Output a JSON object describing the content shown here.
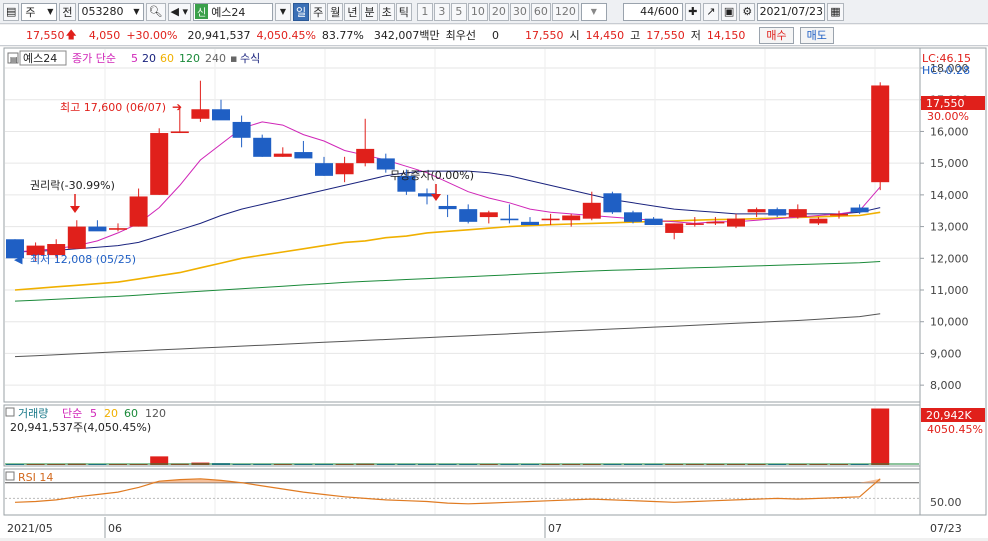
{
  "toolbar": {
    "market": "주",
    "prev_label": "전",
    "code": "053280",
    "type_badge": "신",
    "name": "예스24",
    "periods": [
      "일",
      "주",
      "월",
      "년",
      "분",
      "초",
      "틱"
    ],
    "active_period": "일",
    "intervals": [
      "1",
      "3",
      "5",
      "10",
      "20",
      "30",
      "60",
      "120"
    ],
    "count": "44",
    "count_total": "/600",
    "date": "2021/07/23"
  },
  "quote": {
    "price": "17,550",
    "change": "4,050",
    "change_pct": "+30.00%",
    "volume": "20,941,537",
    "volume_pct": "4,050.45%",
    "ratio": "83.77%",
    "amount": "342,007백만",
    "pref_label": "최우선",
    "pref_value": "0",
    "ask": "17,550",
    "open_label": "시",
    "open": "14,450",
    "high_label": "고",
    "high": "17,550",
    "low_label": "저",
    "low": "14,150",
    "buy_label": "매수",
    "sell_label": "매도"
  },
  "price_panel": {
    "name_tag": "예스24",
    "legend_prefix": "종가 단순",
    "ma": [
      "5",
      "20",
      "60",
      "120",
      "240"
    ],
    "formula_label": "수식",
    "lc": "LC:46.15",
    "hc": "HC:-0.28",
    "last_price_badge": "17,550",
    "last_pct_badge": "30.00%",
    "annotations": {
      "high": "최고 17,600 (06/07)",
      "low": "최저 12,008 (05/25)",
      "rights": "권리락(-30.99%)",
      "bonus": "무상증자(0.00%)"
    },
    "yaxis": [
      "18,000",
      "17,000",
      "16,000",
      "15,000",
      "14,000",
      "13,000",
      "12,000",
      "11,000",
      "10,000",
      "9,000",
      "8,000"
    ]
  },
  "volume_panel": {
    "title": "거래량",
    "legend_prefix": "단순",
    "ma": [
      "5",
      "20",
      "60",
      "120"
    ],
    "value_text": "20,941,537주(4,050.45%)",
    "badge": "20,942K",
    "badge_pct": "4050.45%"
  },
  "rsi_panel": {
    "title": "RSI 14",
    "ytick": "50.00"
  },
  "xaxis": {
    "labels": [
      "2021/05",
      "06",
      "07"
    ],
    "right_label": "07/23"
  },
  "colors": {
    "up": "#e0201b",
    "down": "#1f5fc4",
    "ma5": "#d026b8",
    "ma20": "#1a237e",
    "ma60": "#f0b000",
    "ma120": "#1b8a3a",
    "ma240": "#555555"
  },
  "chart_data": {
    "type": "candlestick",
    "candles": [
      {
        "o": 12600,
        "h": 12600,
        "l": 12000,
        "c": 12000
      },
      {
        "o": 12100,
        "h": 12500,
        "l": 11900,
        "c": 12400
      },
      {
        "o": 12100,
        "h": 12600,
        "l": 12008,
        "c": 12450
      },
      {
        "o": 12300,
        "h": 13200,
        "l": 12300,
        "c": 13000
      },
      {
        "o": 13000,
        "h": 13200,
        "l": 12900,
        "c": 12850
      },
      {
        "o": 12900,
        "h": 13100,
        "l": 12850,
        "c": 12950
      },
      {
        "o": 13000,
        "h": 14200,
        "l": 13000,
        "c": 13950
      },
      {
        "o": 14000,
        "h": 16100,
        "l": 14000,
        "c": 15950
      },
      {
        "o": 15950,
        "h": 16800,
        "l": 15950,
        "c": 16000
      },
      {
        "o": 16400,
        "h": 17600,
        "l": 16300,
        "c": 16700
      },
      {
        "o": 16700,
        "h": 17000,
        "l": 16400,
        "c": 16350
      },
      {
        "o": 16300,
        "h": 16500,
        "l": 15500,
        "c": 15800
      },
      {
        "o": 15800,
        "h": 15900,
        "l": 15200,
        "c": 15200
      },
      {
        "o": 15200,
        "h": 15500,
        "l": 15200,
        "c": 15300
      },
      {
        "o": 15350,
        "h": 15700,
        "l": 15250,
        "c": 15150
      },
      {
        "o": 15000,
        "h": 15200,
        "l": 14600,
        "c": 14600
      },
      {
        "o": 14650,
        "h": 15200,
        "l": 14400,
        "c": 15000
      },
      {
        "o": 15000,
        "h": 16400,
        "l": 14900,
        "c": 15450
      },
      {
        "o": 15150,
        "h": 15300,
        "l": 14700,
        "c": 14800
      },
      {
        "o": 14600,
        "h": 14800,
        "l": 14000,
        "c": 14100
      },
      {
        "o": 14050,
        "h": 14200,
        "l": 13700,
        "c": 13950
      },
      {
        "o": 13650,
        "h": 14000,
        "l": 13300,
        "c": 13550
      },
      {
        "o": 13550,
        "h": 13700,
        "l": 13100,
        "c": 13150
      },
      {
        "o": 13300,
        "h": 13500,
        "l": 13100,
        "c": 13450
      },
      {
        "o": 13250,
        "h": 13700,
        "l": 13100,
        "c": 13200
      },
      {
        "o": 13150,
        "h": 13300,
        "l": 13100,
        "c": 13050
      },
      {
        "o": 13200,
        "h": 13400,
        "l": 13050,
        "c": 13250
      },
      {
        "o": 13200,
        "h": 13400,
        "l": 13000,
        "c": 13350
      },
      {
        "o": 13250,
        "h": 14100,
        "l": 13200,
        "c": 13750
      },
      {
        "o": 14050,
        "h": 14100,
        "l": 13400,
        "c": 13450
      },
      {
        "o": 13450,
        "h": 13500,
        "l": 13100,
        "c": 13150
      },
      {
        "o": 13250,
        "h": 13300,
        "l": 13100,
        "c": 13050
      },
      {
        "o": 12800,
        "h": 13100,
        "l": 12600,
        "c": 13100
      },
      {
        "o": 13100,
        "h": 13300,
        "l": 13000,
        "c": 13100
      },
      {
        "o": 13100,
        "h": 13300,
        "l": 13050,
        "c": 13150
      },
      {
        "o": 13000,
        "h": 13400,
        "l": 12950,
        "c": 13250
      },
      {
        "o": 13450,
        "h": 13600,
        "l": 13300,
        "c": 13550
      },
      {
        "o": 13550,
        "h": 13600,
        "l": 13300,
        "c": 13350
      },
      {
        "o": 13300,
        "h": 13700,
        "l": 13250,
        "c": 13550
      },
      {
        "o": 13100,
        "h": 13300,
        "l": 13050,
        "c": 13250
      },
      {
        "o": 13350,
        "h": 13500,
        "l": 13250,
        "c": 13400
      },
      {
        "o": 13600,
        "h": 13700,
        "l": 13400,
        "c": 13450
      },
      {
        "o": 14400,
        "h": 17550,
        "l": 14150,
        "c": 17450
      }
    ],
    "ylim": [
      7500,
      18600
    ],
    "volume_ylim": [
      0,
      21500
    ],
    "volume": [
      300,
      200,
      250,
      600,
      200,
      150,
      500,
      3200,
      600,
      900,
      700,
      400,
      350,
      250,
      300,
      400,
      300,
      600,
      400,
      350,
      300,
      250,
      200,
      250,
      200,
      150,
      200,
      200,
      400,
      300,
      200,
      200,
      300,
      150,
      200,
      250,
      300,
      200,
      300,
      200,
      200,
      350,
      20942
    ],
    "ma5_values": [
      12200,
      12250,
      12300,
      12400,
      12550,
      12800,
      13100,
      13600,
      14300,
      15100,
      15600,
      16100,
      16300,
      16200,
      15900,
      15700,
      15400,
      15250,
      15100,
      14900,
      14700,
      14400,
      14100,
      13900,
      13750,
      13550,
      13450,
      13400,
      13350,
      13300,
      13250,
      13200,
      13150,
      13100,
      13150,
      13150,
      13200,
      13250,
      13300,
      13350,
      13400,
      13500,
      14250
    ],
    "ma20_values": [
      12200,
      12220,
      12250,
      12300,
      12350,
      12400,
      12500,
      12700,
      12900,
      13100,
      13350,
      13550,
      13700,
      13850,
      14000,
      14150,
      14300,
      14450,
      14600,
      14700,
      14750,
      14750,
      14750,
      14700,
      14600,
      14450,
      14300,
      14150,
      14000,
      13850,
      13750,
      13650,
      13550,
      13500,
      13450,
      13400,
      13400,
      13400,
      13400,
      13400,
      13400,
      13450,
      13600
    ],
    "ma60_values": [
      11000,
      11050,
      11100,
      11150,
      11200,
      11250,
      11350,
      11450,
      11550,
      11700,
      11850,
      12000,
      12100,
      12200,
      12300,
      12400,
      12500,
      12550,
      12650,
      12700,
      12800,
      12850,
      12900,
      12950,
      13000,
      13030,
      13060,
      13080,
      13100,
      13120,
      13140,
      13160,
      13180,
      13200,
      13220,
      13230,
      13250,
      13270,
      13290,
      13310,
      13330,
      13350,
      13450
    ],
    "ma120_values": [
      10650,
      10680,
      10710,
      10740,
      10770,
      10800,
      10840,
      10880,
      10920,
      10960,
      11000,
      11040,
      11080,
      11120,
      11160,
      11200,
      11240,
      11270,
      11300,
      11330,
      11360,
      11390,
      11420,
      11450,
      11480,
      11510,
      11540,
      11570,
      11600,
      11620,
      11640,
      11660,
      11680,
      11700,
      11720,
      11740,
      11760,
      11780,
      11800,
      11820,
      11840,
      11860,
      11900
    ],
    "ma240_values": [
      8900,
      8930,
      8960,
      8990,
      9020,
      9050,
      9080,
      9110,
      9140,
      9170,
      9200,
      9230,
      9260,
      9290,
      9320,
      9350,
      9380,
      9410,
      9440,
      9470,
      9500,
      9530,
      9560,
      9590,
      9620,
      9650,
      9680,
      9710,
      9740,
      9770,
      9800,
      9830,
      9860,
      9890,
      9920,
      9950,
      9980,
      10010,
      10040,
      10080,
      10120,
      10160,
      10250
    ],
    "rsi_values": [
      45,
      46,
      48,
      52,
      55,
      58,
      64,
      72,
      74,
      75,
      73,
      70,
      66,
      62,
      58,
      55,
      52,
      50,
      48,
      47,
      46,
      44,
      43,
      44,
      45,
      46,
      47,
      48,
      49,
      48,
      47,
      46,
      45,
      46,
      47,
      48,
      49,
      50,
      49,
      50,
      51,
      52,
      75
    ],
    "rsi_ylim": [
      30,
      85
    ]
  }
}
